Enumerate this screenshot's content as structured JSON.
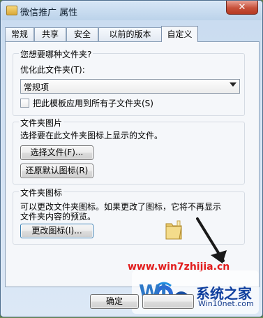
{
  "window": {
    "title": "微信推广 属性",
    "close_label": "✕"
  },
  "tabs": [
    {
      "label": "常规"
    },
    {
      "label": "共享"
    },
    {
      "label": "安全"
    },
    {
      "label": "以前的版本"
    },
    {
      "label": "自定义"
    }
  ],
  "content": {
    "question": "您想要哪种文件夹?",
    "optimize_label": "优化此文件夹(T):",
    "optimize_value": "常规项",
    "apply_template_label": "把此模板应用到所有子文件夹(S)",
    "folder_pictures_title": "文件夹图片",
    "folder_pictures_desc": "选择要在此文件夹图标上显示的文件。",
    "choose_file_button": "选择文件(F)...",
    "restore_icon_button": "还原默认图标(R)",
    "folder_icon_title": "文件夹图标",
    "folder_icon_desc_1": "可以更改文件夹图标。如果更改了图标，它将不再显示",
    "folder_icon_desc_2": "文件夹内容的预览。",
    "change_icon_button": "更改图标(I)..."
  },
  "footer": {
    "ok_label": "确定"
  },
  "watermark": {
    "url": "www.win7zhijia.cn",
    "brand_primary": "系统之家",
    "brand_secondary": "Win10net.com",
    "brand_fragment": "Wi"
  },
  "colors": {
    "accent": "#3c7fb1",
    "close": "#c7503a",
    "watermark_red": "#e21c1c"
  }
}
